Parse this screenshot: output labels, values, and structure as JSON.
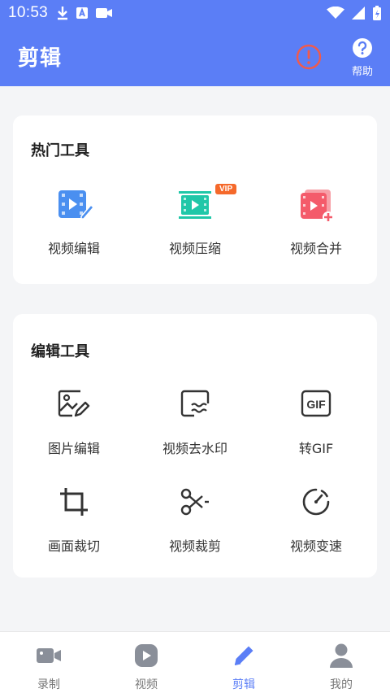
{
  "status_bar": {
    "time": "10:53"
  },
  "app_bar": {
    "title": "剪辑",
    "help_label": "帮助"
  },
  "hot_tools": {
    "title": "热门工具",
    "items": [
      {
        "label": "视频编辑",
        "icon": "video-edit-icon",
        "color": "#4a8ff0"
      },
      {
        "label": "视频压缩",
        "icon": "video-compress-icon",
        "color": "#1fc7a8",
        "badge": "VIP"
      },
      {
        "label": "视频合并",
        "icon": "video-merge-icon",
        "color": "#f45b6b"
      }
    ]
  },
  "edit_tools": {
    "title": "编辑工具",
    "items": [
      {
        "label": "图片编辑",
        "icon": "image-edit-icon"
      },
      {
        "label": "视频去水印",
        "icon": "watermark-remove-icon"
      },
      {
        "label": "转GIF",
        "icon": "gif-icon"
      },
      {
        "label": "画面裁切",
        "icon": "crop-icon"
      },
      {
        "label": "视频裁剪",
        "icon": "scissors-icon"
      },
      {
        "label": "视频变速",
        "icon": "speed-icon"
      }
    ]
  },
  "tab_bar": {
    "items": [
      {
        "label": "录制",
        "icon": "camera-icon"
      },
      {
        "label": "视频",
        "icon": "play-icon"
      },
      {
        "label": "剪辑",
        "icon": "pencil-icon",
        "active": true
      },
      {
        "label": "我的",
        "icon": "person-icon"
      }
    ]
  },
  "colors": {
    "primary": "#5b7ef6",
    "alert": "#f25a4a",
    "vip": "#f5692b"
  }
}
